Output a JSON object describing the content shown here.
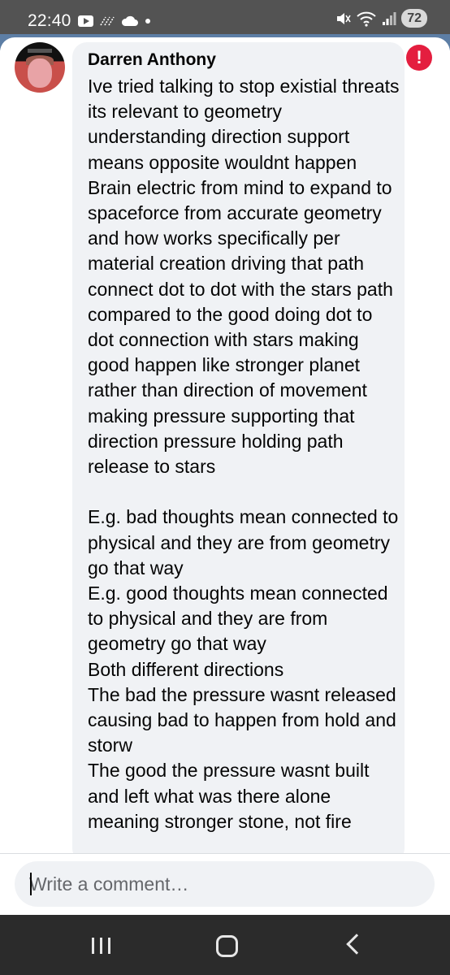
{
  "status_bar": {
    "time": "22:40",
    "battery": "72",
    "left_icons": [
      "youtube-icon",
      "signal-dots-icon",
      "cloud-icon",
      "dot-icon"
    ],
    "right_icons": [
      "mute-icon",
      "wifi-icon",
      "signal-icon"
    ]
  },
  "comment": {
    "author": "Darren Anthony",
    "text": "Ive tried talking to stop existial threats its relevant to geometry understanding direction support means opposite wouldnt happen Brain electric from mind to expand to spaceforce from accurate geometry and how works specifically per material creation driving that path connect dot to dot with the stars path compared to the good doing dot to dot connection with stars making good happen like stronger planet rather than direction of movement making pressure supporting that direction pressure holding path release to stars\n\nE.g. bad thoughts mean connected to physical and they are from geometry go that way\nE.g. good thoughts mean connected to physical and they are from geometry go that way\nBoth different directions\nThe bad the pressure wasnt released causing bad to happen from hold and storw\nThe good the pressure wasnt built and left what was there alone meaning stronger stone, not fire"
  },
  "composer": {
    "placeholder": "Write a comment…"
  },
  "nav": {
    "buttons": [
      "recents-button",
      "home-button",
      "back-button"
    ]
  },
  "colors": {
    "status_bar_bg": "#535353",
    "bubble_bg": "#f0f2f5",
    "alert_red": "#e41e3f",
    "nav_bg": "#2b2b2b"
  }
}
